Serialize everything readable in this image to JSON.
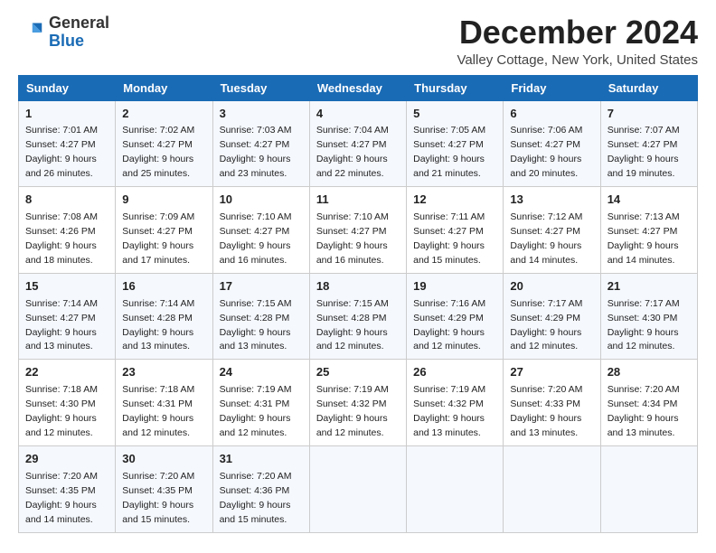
{
  "header": {
    "logo_general": "General",
    "logo_blue": "Blue",
    "month_title": "December 2024",
    "location": "Valley Cottage, New York, United States"
  },
  "days_of_week": [
    "Sunday",
    "Monday",
    "Tuesday",
    "Wednesday",
    "Thursday",
    "Friday",
    "Saturday"
  ],
  "weeks": [
    [
      {
        "day": "1",
        "sunrise": "Sunrise: 7:01 AM",
        "sunset": "Sunset: 4:27 PM",
        "daylight": "Daylight: 9 hours and 26 minutes."
      },
      {
        "day": "2",
        "sunrise": "Sunrise: 7:02 AM",
        "sunset": "Sunset: 4:27 PM",
        "daylight": "Daylight: 9 hours and 25 minutes."
      },
      {
        "day": "3",
        "sunrise": "Sunrise: 7:03 AM",
        "sunset": "Sunset: 4:27 PM",
        "daylight": "Daylight: 9 hours and 23 minutes."
      },
      {
        "day": "4",
        "sunrise": "Sunrise: 7:04 AM",
        "sunset": "Sunset: 4:27 PM",
        "daylight": "Daylight: 9 hours and 22 minutes."
      },
      {
        "day": "5",
        "sunrise": "Sunrise: 7:05 AM",
        "sunset": "Sunset: 4:27 PM",
        "daylight": "Daylight: 9 hours and 21 minutes."
      },
      {
        "day": "6",
        "sunrise": "Sunrise: 7:06 AM",
        "sunset": "Sunset: 4:27 PM",
        "daylight": "Daylight: 9 hours and 20 minutes."
      },
      {
        "day": "7",
        "sunrise": "Sunrise: 7:07 AM",
        "sunset": "Sunset: 4:27 PM",
        "daylight": "Daylight: 9 hours and 19 minutes."
      }
    ],
    [
      {
        "day": "8",
        "sunrise": "Sunrise: 7:08 AM",
        "sunset": "Sunset: 4:26 PM",
        "daylight": "Daylight: 9 hours and 18 minutes."
      },
      {
        "day": "9",
        "sunrise": "Sunrise: 7:09 AM",
        "sunset": "Sunset: 4:27 PM",
        "daylight": "Daylight: 9 hours and 17 minutes."
      },
      {
        "day": "10",
        "sunrise": "Sunrise: 7:10 AM",
        "sunset": "Sunset: 4:27 PM",
        "daylight": "Daylight: 9 hours and 16 minutes."
      },
      {
        "day": "11",
        "sunrise": "Sunrise: 7:10 AM",
        "sunset": "Sunset: 4:27 PM",
        "daylight": "Daylight: 9 hours and 16 minutes."
      },
      {
        "day": "12",
        "sunrise": "Sunrise: 7:11 AM",
        "sunset": "Sunset: 4:27 PM",
        "daylight": "Daylight: 9 hours and 15 minutes."
      },
      {
        "day": "13",
        "sunrise": "Sunrise: 7:12 AM",
        "sunset": "Sunset: 4:27 PM",
        "daylight": "Daylight: 9 hours and 14 minutes."
      },
      {
        "day": "14",
        "sunrise": "Sunrise: 7:13 AM",
        "sunset": "Sunset: 4:27 PM",
        "daylight": "Daylight: 9 hours and 14 minutes."
      }
    ],
    [
      {
        "day": "15",
        "sunrise": "Sunrise: 7:14 AM",
        "sunset": "Sunset: 4:27 PM",
        "daylight": "Daylight: 9 hours and 13 minutes."
      },
      {
        "day": "16",
        "sunrise": "Sunrise: 7:14 AM",
        "sunset": "Sunset: 4:28 PM",
        "daylight": "Daylight: 9 hours and 13 minutes."
      },
      {
        "day": "17",
        "sunrise": "Sunrise: 7:15 AM",
        "sunset": "Sunset: 4:28 PM",
        "daylight": "Daylight: 9 hours and 13 minutes."
      },
      {
        "day": "18",
        "sunrise": "Sunrise: 7:15 AM",
        "sunset": "Sunset: 4:28 PM",
        "daylight": "Daylight: 9 hours and 12 minutes."
      },
      {
        "day": "19",
        "sunrise": "Sunrise: 7:16 AM",
        "sunset": "Sunset: 4:29 PM",
        "daylight": "Daylight: 9 hours and 12 minutes."
      },
      {
        "day": "20",
        "sunrise": "Sunrise: 7:17 AM",
        "sunset": "Sunset: 4:29 PM",
        "daylight": "Daylight: 9 hours and 12 minutes."
      },
      {
        "day": "21",
        "sunrise": "Sunrise: 7:17 AM",
        "sunset": "Sunset: 4:30 PM",
        "daylight": "Daylight: 9 hours and 12 minutes."
      }
    ],
    [
      {
        "day": "22",
        "sunrise": "Sunrise: 7:18 AM",
        "sunset": "Sunset: 4:30 PM",
        "daylight": "Daylight: 9 hours and 12 minutes."
      },
      {
        "day": "23",
        "sunrise": "Sunrise: 7:18 AM",
        "sunset": "Sunset: 4:31 PM",
        "daylight": "Daylight: 9 hours and 12 minutes."
      },
      {
        "day": "24",
        "sunrise": "Sunrise: 7:19 AM",
        "sunset": "Sunset: 4:31 PM",
        "daylight": "Daylight: 9 hours and 12 minutes."
      },
      {
        "day": "25",
        "sunrise": "Sunrise: 7:19 AM",
        "sunset": "Sunset: 4:32 PM",
        "daylight": "Daylight: 9 hours and 12 minutes."
      },
      {
        "day": "26",
        "sunrise": "Sunrise: 7:19 AM",
        "sunset": "Sunset: 4:32 PM",
        "daylight": "Daylight: 9 hours and 13 minutes."
      },
      {
        "day": "27",
        "sunrise": "Sunrise: 7:20 AM",
        "sunset": "Sunset: 4:33 PM",
        "daylight": "Daylight: 9 hours and 13 minutes."
      },
      {
        "day": "28",
        "sunrise": "Sunrise: 7:20 AM",
        "sunset": "Sunset: 4:34 PM",
        "daylight": "Daylight: 9 hours and 13 minutes."
      }
    ],
    [
      {
        "day": "29",
        "sunrise": "Sunrise: 7:20 AM",
        "sunset": "Sunset: 4:35 PM",
        "daylight": "Daylight: 9 hours and 14 minutes."
      },
      {
        "day": "30",
        "sunrise": "Sunrise: 7:20 AM",
        "sunset": "Sunset: 4:35 PM",
        "daylight": "Daylight: 9 hours and 15 minutes."
      },
      {
        "day": "31",
        "sunrise": "Sunrise: 7:20 AM",
        "sunset": "Sunset: 4:36 PM",
        "daylight": "Daylight: 9 hours and 15 minutes."
      },
      null,
      null,
      null,
      null
    ]
  ]
}
